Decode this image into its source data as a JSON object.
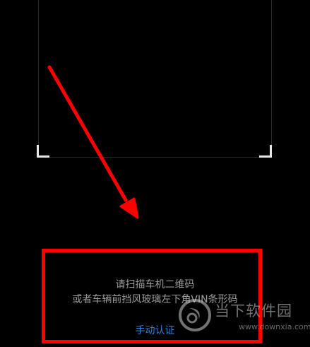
{
  "scanner": {
    "hint_line_1": "请扫描车机二维码",
    "hint_line_2": "或者车辆前挡风玻璃左下角VIN条形码",
    "manual_auth_label": "手动认证"
  },
  "watermark": {
    "title": "当下软件园",
    "url": "www.downxia.com"
  },
  "colors": {
    "background": "#000000",
    "annotation": "#ff0000",
    "link": "#2f7fd6",
    "hint_text": "#9a9a9a"
  },
  "icons": {
    "watermark_logo": "downxia-logo-icon",
    "annotation_arrow": "red-arrow-icon"
  }
}
